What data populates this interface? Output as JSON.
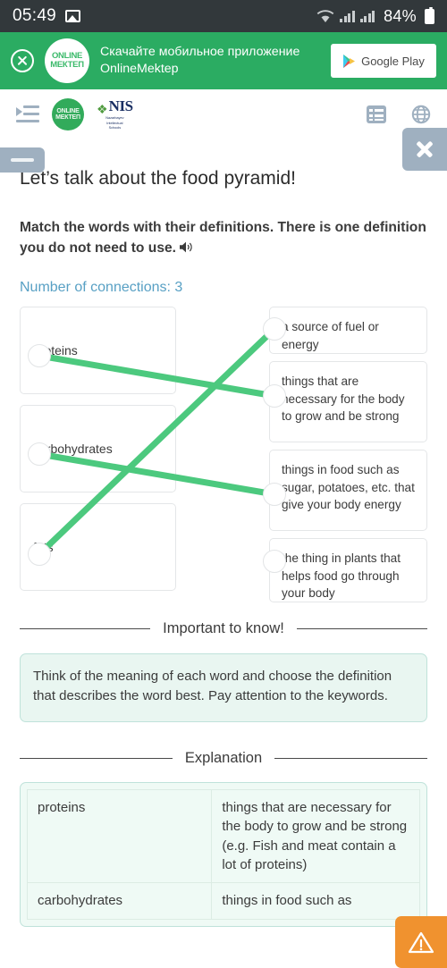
{
  "statusbar": {
    "time": "05:49",
    "gallery_icon": "image-icon",
    "wifi_icon": "wifi-icon",
    "signal_icon": "signal-bars-icon",
    "battery_percent": "84%",
    "battery_icon": "battery-icon"
  },
  "promo": {
    "close_icon": "close-circle-icon",
    "logo_line1": "ONLINE",
    "logo_line2": "МЕКТЕП",
    "text_line1": "Скачайте мобильное приложение",
    "text_line2": "OnlineMektep",
    "store_button_label": "Google Play",
    "store_icon": "google-play-icon",
    "background_color": "#2bac62"
  },
  "navbar": {
    "menu_icon": "indent-menu-icon",
    "brand_om_line1": "ONLINE",
    "brand_om_line2": "МЕКТЕП",
    "brand_nis_word": "NIS",
    "brand_nis_sub_line1": "Nazarbayev",
    "brand_nis_sub_line2": "Intellectual",
    "brand_nis_sub_line3": "Schools",
    "list_icon": "list-view-icon",
    "globe_icon": "globe-icon",
    "close_icon": "close-x-icon",
    "handle_icon": "drag-handle-icon"
  },
  "lesson": {
    "title": "Let’s talk about the food pyramid!",
    "instruction": "Match the words with their definitions. There is one definition you do not need to use.",
    "audio_icon": "speaker-icon",
    "connections_label": "Number of connections: 3",
    "connections_count": 3,
    "accent_color": "#58a0c4",
    "link_color": "#4cc97e"
  },
  "matching": {
    "words": [
      {
        "label": "proteins"
      },
      {
        "label": "carbohydrates"
      },
      {
        "label": "fats"
      }
    ],
    "definitions": [
      {
        "label": "a source of fuel or energy"
      },
      {
        "label": "things that are necessary for the body to grow and be strong"
      },
      {
        "label": "things in food such as sugar, potatoes, etc. that give your body energy"
      },
      {
        "label": "the thing in plants that helps food go through your body"
      }
    ],
    "links": [
      {
        "from_word": 0,
        "to_definition": 1
      },
      {
        "from_word": 1,
        "to_definition": 2
      },
      {
        "from_word": 2,
        "to_definition": 0
      }
    ]
  },
  "important": {
    "heading": "Important to know!",
    "body": "Think of the meaning of each word and choose the definition that describes the word best. Pay attention to the keywords."
  },
  "explanation": {
    "heading": "Explanation",
    "rows": [
      {
        "word": "proteins",
        "definition": "things that are necessary for the body to grow and be strong (e.g. Fish and meat contain a lot of proteins)"
      },
      {
        "word": "carbohydrates",
        "definition": "things in food such as"
      }
    ]
  },
  "report": {
    "icon": "warning-triangle-icon",
    "color": "#f0922f"
  }
}
